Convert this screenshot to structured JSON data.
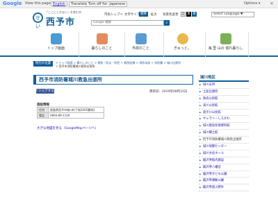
{
  "translate_bar": {
    "logo": "Google",
    "view_text": "View this page in:",
    "language": "English",
    "translate_btn": "Translate",
    "turn_off_btn": "Turn off for: Japanese",
    "options": "Options ▾",
    "close": "×"
  },
  "header": {
    "catchphrase": "「ここにしかない」を育む市",
    "city_name": "西予市",
    "link_home": "市民トップへ",
    "text_size_label": "文字サイズ",
    "text_size_standard": "標準",
    "text_size_large": "拡大",
    "color_label": "背景色変更",
    "language_select": "Select Language ▼",
    "search_placeholder": "Google 検索",
    "search_icon": "search-icon"
  },
  "nav": [
    {
      "label": "トップ画面",
      "icon": "home-icon",
      "color": "#4a9ad4"
    },
    {
      "label": "暮らしのこと",
      "icon": "family-icon",
      "color": "#e48c5c"
    },
    {
      "label": "市政のこと",
      "icon": "building-icon",
      "color": "#5a9bd4"
    },
    {
      "label": "ぎゅっと。",
      "icon": "mascot-icon",
      "color": "#e8b84a"
    },
    {
      "label": "海 里 山の\n億れ暮らし",
      "icon": "landscape-icon",
      "color": "#7ab05a"
    }
  ],
  "breadcrumb": {
    "here_label": "現在の位置",
    "items": [
      "トップ画面",
      "暮らしのこと",
      "救急・防災・防犯",
      "救急医療",
      "消防本部",
      "消防署",
      "城川出張所"
    ],
    "current": "西予市消防署城川救急出張所"
  },
  "page": {
    "title": "西予市消防署城川救急出張所",
    "share_label": "f シェアする",
    "updated": "更新日：2019年08月31日",
    "info_title": "施設情報",
    "table": [
      {
        "key": "住所",
        "value": "愛媛県西予市城川町下相1005番地2"
      },
      {
        "key": "電話",
        "value": "0894-89-1119"
      }
    ],
    "map_link": "大きな地図を見る（GoogleMapページへ）"
  },
  "sidebar": {
    "title": "城川地区",
    "items": [
      "城川支所",
      "土居出張所",
      "魚成公民館",
      "高川公民館",
      "遊子川公民館",
      "ギャラリーしろかわ",
      "城川歴史民俗資料館",
      "城川郷土館",
      "西予市消防署城川救急出張所",
      "城川保健センター",
      "城川文化ホール",
      "龍沢寺館内施設",
      "龍沢寺八幡宮",
      "龍沢寺子ども公園",
      "龍沢寺運動公園",
      "龍沢寺遊ぶ野外"
    ],
    "current_index": 8
  }
}
